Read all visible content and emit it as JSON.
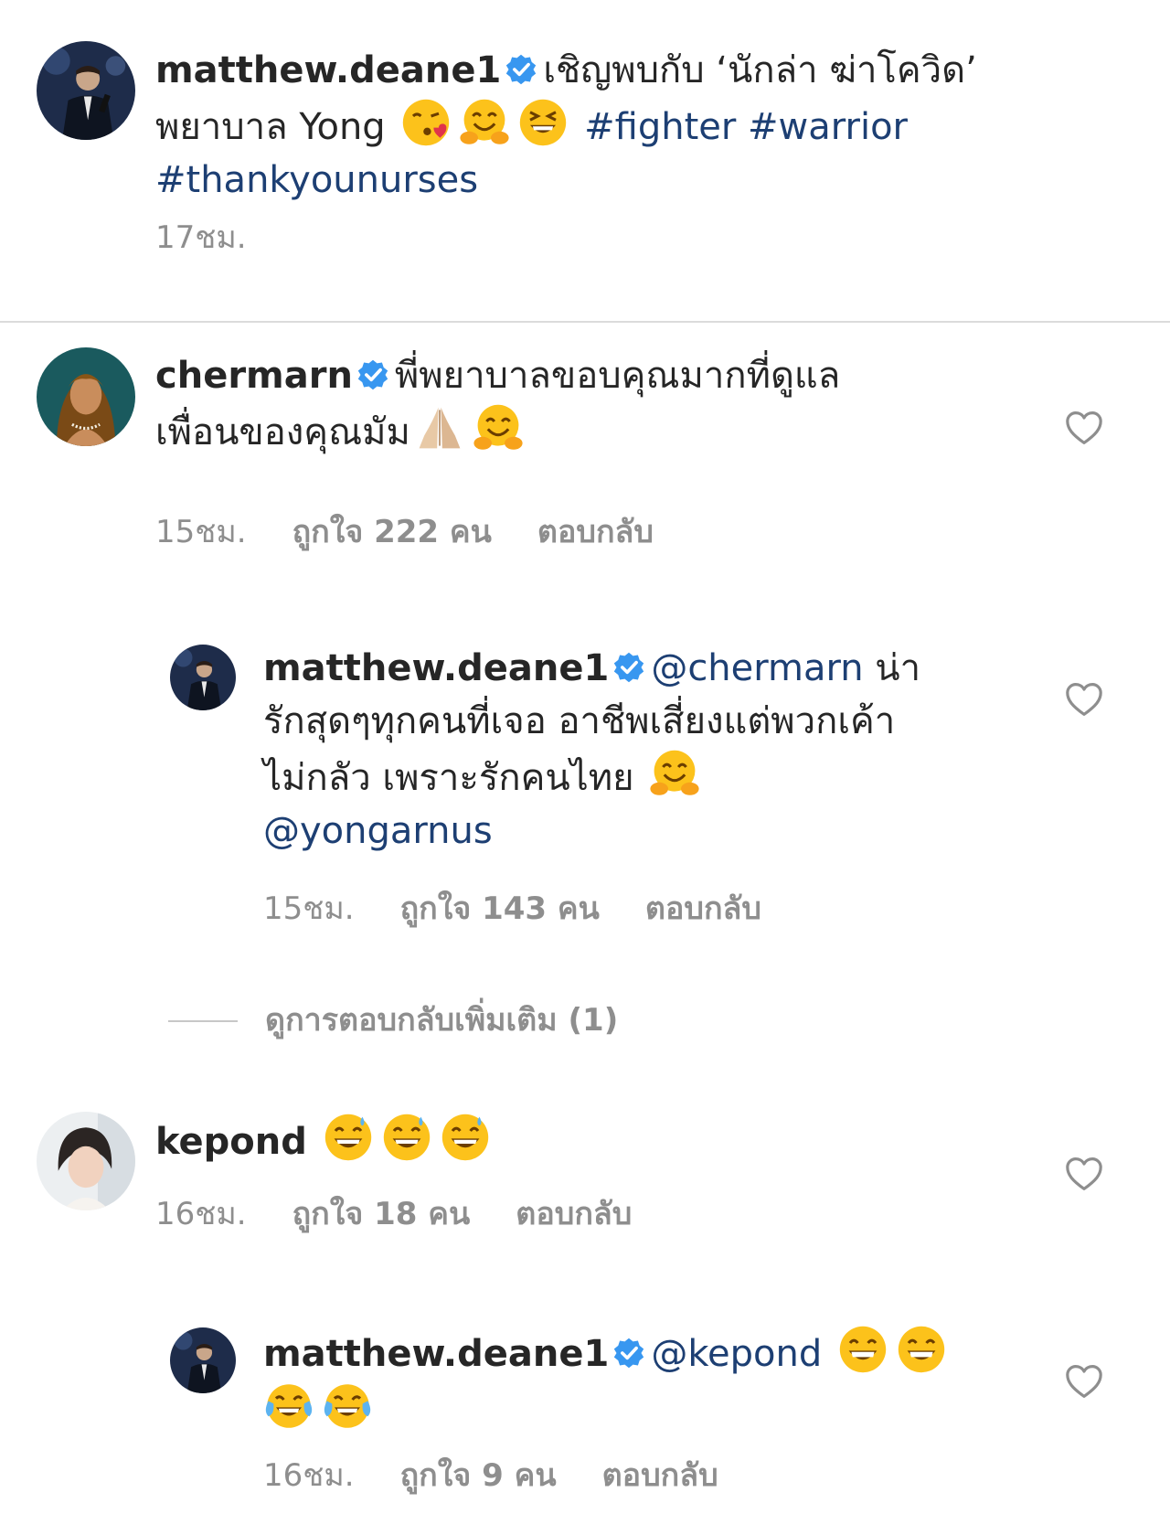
{
  "post": {
    "username": "matthew.deane1",
    "caption_text": "เชิญพบกับ ‘นักล่า ฆ่าโควิด’",
    "caption_line2": "พยาบาล Yong",
    "hashtags": "#fighter #warrior",
    "hashtag_line3": "#thankyounurses",
    "time": "17ชม."
  },
  "comments": [
    {
      "username": "chermarn",
      "text_line1": "พี่พยาบาลขอบคุณมากที่ดูแล",
      "text_line2": "เพื่อนของคุณมัม",
      "time": "15ชม.",
      "likes": "ถูกใจ 222 คน",
      "reply_label": "ตอบกลับ"
    },
    {
      "username": "matthew.deane1",
      "mention": "@chermarn",
      "text_line1_tail": "น่า",
      "text_line2": "รักสุดๆทุกคนที่เจอ อาชีพเสี่ยงแต่พวกเค้า",
      "text_line3": "ไม่กลัว เพราะรักคนไทย",
      "mention2": "@yongarnus",
      "time": "15ชม.",
      "likes": "ถูกใจ 143 คน",
      "reply_label": "ตอบกลับ"
    },
    {
      "username": "kepond",
      "time": "16ชม.",
      "likes": "ถูกใจ 18 คน",
      "reply_label": "ตอบกลับ"
    },
    {
      "username": "matthew.deane1",
      "mention": "@kepond",
      "time": "16ชม.",
      "likes": "ถูกใจ 9 คน",
      "reply_label": "ตอบกลับ"
    }
  ],
  "view_more_replies": "ดูการตอบกลับเพิ่มเติม (1)",
  "icons": {
    "verified": "verified-badge-icon",
    "heart": "heart-outline-icon"
  },
  "colors": {
    "link": "#1d3f73",
    "verified": "#3897f0",
    "meta": "#8e8e8e"
  }
}
